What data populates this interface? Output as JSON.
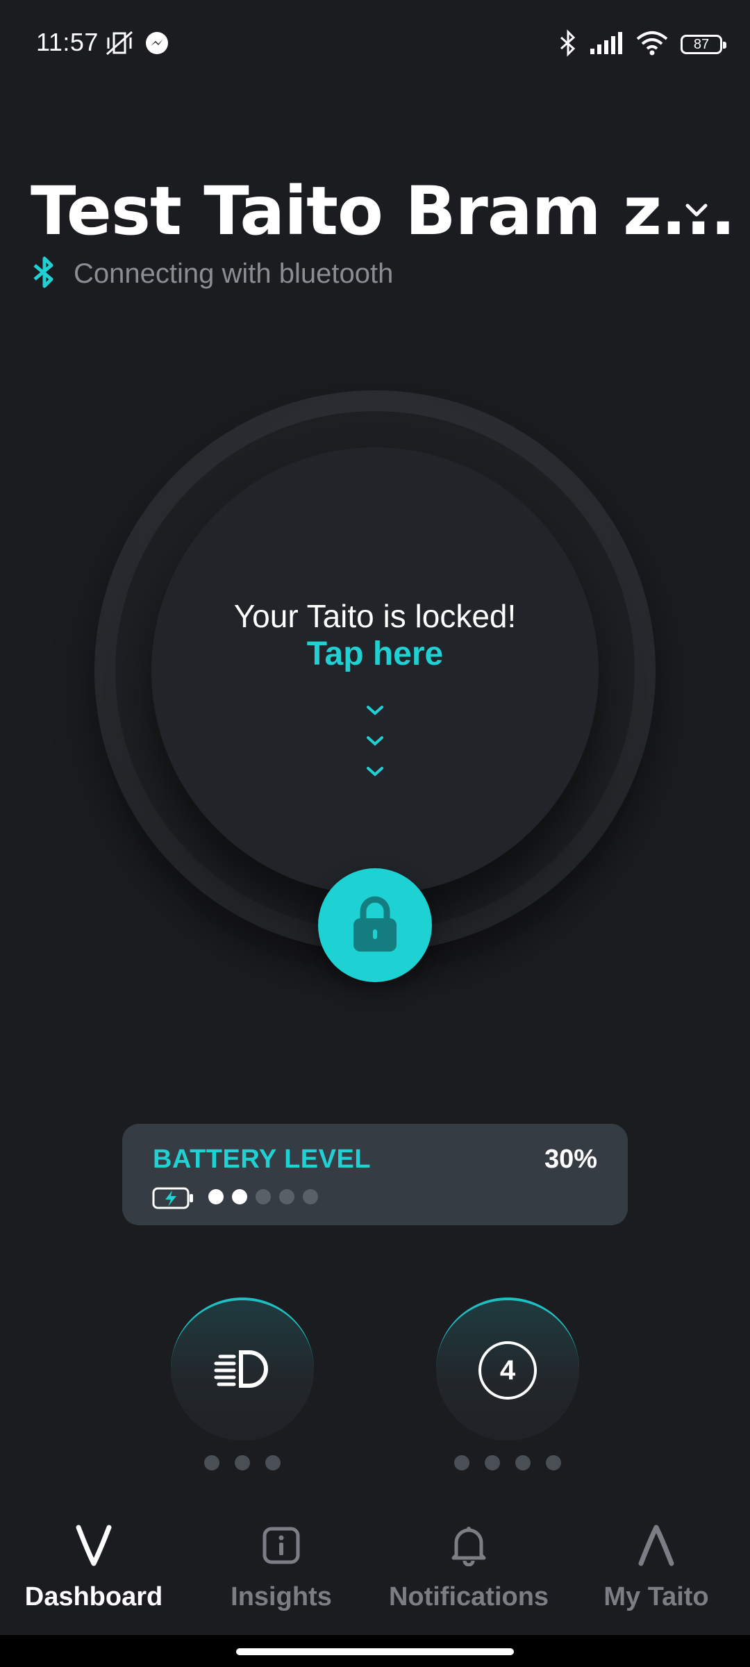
{
  "status_bar": {
    "time": "11:57",
    "icons_left": [
      "vibrate-off-icon",
      "messenger-icon"
    ],
    "icons_right": [
      "bluetooth-icon",
      "signal-icon",
      "wifi-icon"
    ],
    "battery": "87"
  },
  "header": {
    "title": "Test Taito Bram z...",
    "connection_status": "Connecting with bluetooth"
  },
  "dial": {
    "message": "Your Taito is locked!",
    "action": "Tap here"
  },
  "battery": {
    "label": "BATTERY LEVEL",
    "value": "30%",
    "level_fraction": 0.3,
    "dots_total": 5,
    "dots_filled": 2
  },
  "modes": {
    "light": {
      "icon": "headlight-icon",
      "levels": 3
    },
    "speed": {
      "value": "4",
      "levels": 4
    }
  },
  "nav": {
    "items": [
      {
        "label": "Dashboard",
        "icon": "taito-v-icon",
        "active": true
      },
      {
        "label": "Insights",
        "icon": "info-icon",
        "active": false
      },
      {
        "label": "Notifications",
        "icon": "bell-icon",
        "active": false
      },
      {
        "label": "My Taito",
        "icon": "taito-a-icon",
        "active": false
      }
    ]
  },
  "colors": {
    "accent": "#1ed2d4",
    "background": "#1b1c20",
    "card": "#363c43"
  }
}
